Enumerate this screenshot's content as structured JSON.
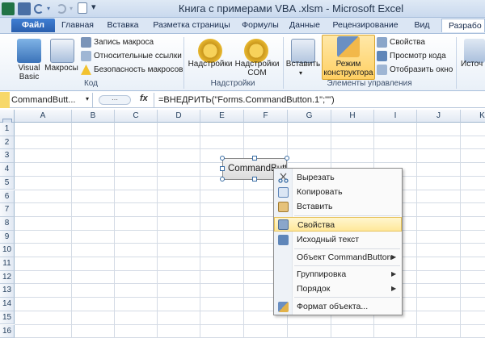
{
  "window": {
    "title": "Книга с примерами VBA .xlsm  -  Microsoft Excel"
  },
  "tabs": [
    {
      "label": "Файл"
    },
    {
      "label": "Главная"
    },
    {
      "label": "Вставка"
    },
    {
      "label": "Разметка страницы"
    },
    {
      "label": "Формулы"
    },
    {
      "label": "Данные"
    },
    {
      "label": "Рецензирование"
    },
    {
      "label": "Вид"
    },
    {
      "label": "Разрабо"
    }
  ],
  "ribbon": {
    "code_group": {
      "label": "Код",
      "visual_basic": "Visual Basic",
      "macros": "Макросы",
      "record_macro": "Запись макроса",
      "relative_refs": "Относительные ссылки",
      "macro_security": "Безопасность макросов"
    },
    "addins_group": {
      "label": "Надстройки",
      "addins": "Надстройки",
      "com_addins_line1": "Надстройки",
      "com_addins_line2": "COM"
    },
    "controls_group": {
      "label": "Элементы управления",
      "insert": "Вставить",
      "design_mode_line1": "Режим",
      "design_mode_line2": "конструктора",
      "properties": "Свойства",
      "view_code": "Просмотр кода",
      "run_dialog": "Отобразить окно"
    },
    "source_partial": "Источ"
  },
  "formula_bar": {
    "name_box": "CommandButt...",
    "fx": "fx",
    "formula": "=ВНЕДРИТЬ(\"Forms.CommandButton.1\";\"\")"
  },
  "grid": {
    "columns": [
      "A",
      "B",
      "C",
      "D",
      "E",
      "F",
      "G",
      "H",
      "I",
      "J",
      "K"
    ],
    "rows": [
      "1",
      "2",
      "3",
      "4",
      "5",
      "6",
      "7",
      "8",
      "9",
      "10",
      "11",
      "12",
      "13",
      "14",
      "15",
      "16"
    ]
  },
  "command_button": {
    "label": "CommandButton1"
  },
  "context_menu": {
    "items": [
      {
        "label": "Вырезать"
      },
      {
        "label": "Копировать"
      },
      {
        "label": "Вставить"
      },
      {
        "label": "Свойства"
      },
      {
        "label": "Исходный текст"
      },
      {
        "label": "Объект CommandButton"
      },
      {
        "label": "Группировка"
      },
      {
        "label": "Порядок"
      },
      {
        "label": "Формат объекта..."
      }
    ]
  },
  "colors": {
    "accent": "#2a5fae",
    "highlight": "#ffe89a",
    "ribbon_bg": "#e9f0f8"
  }
}
